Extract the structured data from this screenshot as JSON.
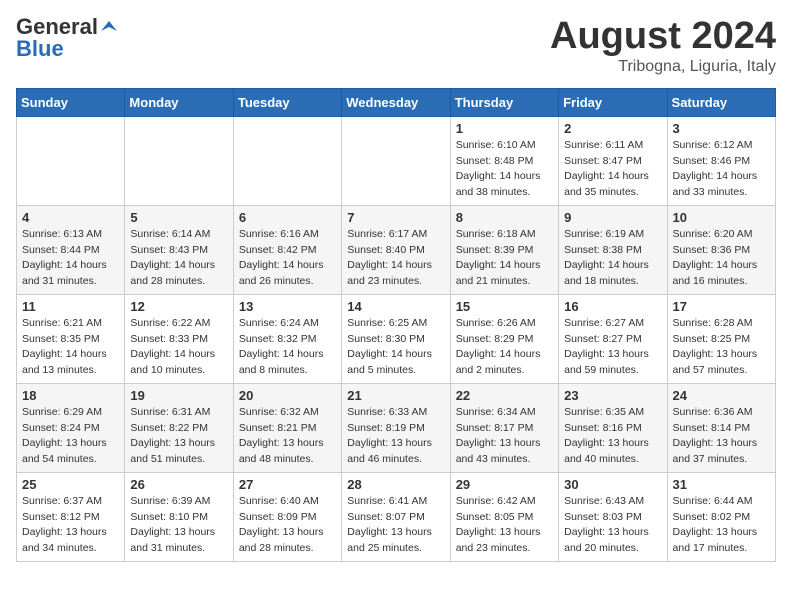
{
  "header": {
    "logo_general": "General",
    "logo_blue": "Blue",
    "month_title": "August 2024",
    "location": "Tribogna, Liguria, Italy"
  },
  "days_of_week": [
    "Sunday",
    "Monday",
    "Tuesday",
    "Wednesday",
    "Thursday",
    "Friday",
    "Saturday"
  ],
  "weeks": [
    [
      {
        "day": "",
        "info": ""
      },
      {
        "day": "",
        "info": ""
      },
      {
        "day": "",
        "info": ""
      },
      {
        "day": "",
        "info": ""
      },
      {
        "day": "1",
        "info": "Sunrise: 6:10 AM\nSunset: 8:48 PM\nDaylight: 14 hours\nand 38 minutes."
      },
      {
        "day": "2",
        "info": "Sunrise: 6:11 AM\nSunset: 8:47 PM\nDaylight: 14 hours\nand 35 minutes."
      },
      {
        "day": "3",
        "info": "Sunrise: 6:12 AM\nSunset: 8:46 PM\nDaylight: 14 hours\nand 33 minutes."
      }
    ],
    [
      {
        "day": "4",
        "info": "Sunrise: 6:13 AM\nSunset: 8:44 PM\nDaylight: 14 hours\nand 31 minutes."
      },
      {
        "day": "5",
        "info": "Sunrise: 6:14 AM\nSunset: 8:43 PM\nDaylight: 14 hours\nand 28 minutes."
      },
      {
        "day": "6",
        "info": "Sunrise: 6:16 AM\nSunset: 8:42 PM\nDaylight: 14 hours\nand 26 minutes."
      },
      {
        "day": "7",
        "info": "Sunrise: 6:17 AM\nSunset: 8:40 PM\nDaylight: 14 hours\nand 23 minutes."
      },
      {
        "day": "8",
        "info": "Sunrise: 6:18 AM\nSunset: 8:39 PM\nDaylight: 14 hours\nand 21 minutes."
      },
      {
        "day": "9",
        "info": "Sunrise: 6:19 AM\nSunset: 8:38 PM\nDaylight: 14 hours\nand 18 minutes."
      },
      {
        "day": "10",
        "info": "Sunrise: 6:20 AM\nSunset: 8:36 PM\nDaylight: 14 hours\nand 16 minutes."
      }
    ],
    [
      {
        "day": "11",
        "info": "Sunrise: 6:21 AM\nSunset: 8:35 PM\nDaylight: 14 hours\nand 13 minutes."
      },
      {
        "day": "12",
        "info": "Sunrise: 6:22 AM\nSunset: 8:33 PM\nDaylight: 14 hours\nand 10 minutes."
      },
      {
        "day": "13",
        "info": "Sunrise: 6:24 AM\nSunset: 8:32 PM\nDaylight: 14 hours\nand 8 minutes."
      },
      {
        "day": "14",
        "info": "Sunrise: 6:25 AM\nSunset: 8:30 PM\nDaylight: 14 hours\nand 5 minutes."
      },
      {
        "day": "15",
        "info": "Sunrise: 6:26 AM\nSunset: 8:29 PM\nDaylight: 14 hours\nand 2 minutes."
      },
      {
        "day": "16",
        "info": "Sunrise: 6:27 AM\nSunset: 8:27 PM\nDaylight: 13 hours\nand 59 minutes."
      },
      {
        "day": "17",
        "info": "Sunrise: 6:28 AM\nSunset: 8:25 PM\nDaylight: 13 hours\nand 57 minutes."
      }
    ],
    [
      {
        "day": "18",
        "info": "Sunrise: 6:29 AM\nSunset: 8:24 PM\nDaylight: 13 hours\nand 54 minutes."
      },
      {
        "day": "19",
        "info": "Sunrise: 6:31 AM\nSunset: 8:22 PM\nDaylight: 13 hours\nand 51 minutes."
      },
      {
        "day": "20",
        "info": "Sunrise: 6:32 AM\nSunset: 8:21 PM\nDaylight: 13 hours\nand 48 minutes."
      },
      {
        "day": "21",
        "info": "Sunrise: 6:33 AM\nSunset: 8:19 PM\nDaylight: 13 hours\nand 46 minutes."
      },
      {
        "day": "22",
        "info": "Sunrise: 6:34 AM\nSunset: 8:17 PM\nDaylight: 13 hours\nand 43 minutes."
      },
      {
        "day": "23",
        "info": "Sunrise: 6:35 AM\nSunset: 8:16 PM\nDaylight: 13 hours\nand 40 minutes."
      },
      {
        "day": "24",
        "info": "Sunrise: 6:36 AM\nSunset: 8:14 PM\nDaylight: 13 hours\nand 37 minutes."
      }
    ],
    [
      {
        "day": "25",
        "info": "Sunrise: 6:37 AM\nSunset: 8:12 PM\nDaylight: 13 hours\nand 34 minutes."
      },
      {
        "day": "26",
        "info": "Sunrise: 6:39 AM\nSunset: 8:10 PM\nDaylight: 13 hours\nand 31 minutes."
      },
      {
        "day": "27",
        "info": "Sunrise: 6:40 AM\nSunset: 8:09 PM\nDaylight: 13 hours\nand 28 minutes."
      },
      {
        "day": "28",
        "info": "Sunrise: 6:41 AM\nSunset: 8:07 PM\nDaylight: 13 hours\nand 25 minutes."
      },
      {
        "day": "29",
        "info": "Sunrise: 6:42 AM\nSunset: 8:05 PM\nDaylight: 13 hours\nand 23 minutes."
      },
      {
        "day": "30",
        "info": "Sunrise: 6:43 AM\nSunset: 8:03 PM\nDaylight: 13 hours\nand 20 minutes."
      },
      {
        "day": "31",
        "info": "Sunrise: 6:44 AM\nSunset: 8:02 PM\nDaylight: 13 hours\nand 17 minutes."
      }
    ]
  ]
}
